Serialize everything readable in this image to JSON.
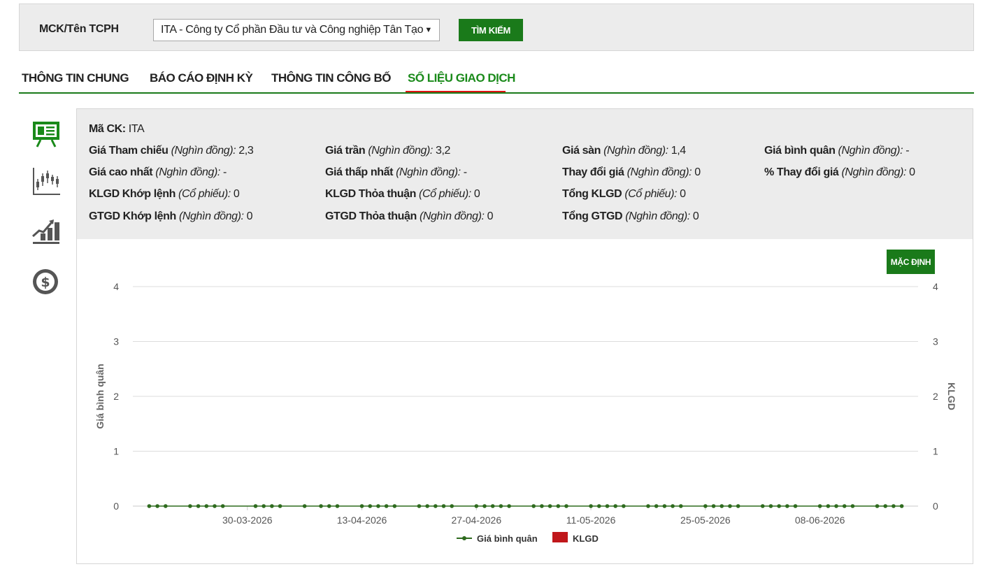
{
  "search": {
    "label": "MCK/Tên TCPH",
    "selected_company": "ITA - Công ty Cổ phần Đầu tư và Công nghiệp Tân Tạo",
    "button_label": "TÌM KIẾM"
  },
  "tabs": [
    {
      "label": "THÔNG TIN CHUNG"
    },
    {
      "label": "BÁO CÁO ĐỊNH KỲ"
    },
    {
      "label": "THÔNG TIN CÔNG BỐ"
    },
    {
      "label": "SỐ LIỆU GIAO DỊCH"
    }
  ],
  "active_tab": "SỐ LIỆU GIAO DỊCH",
  "side_icons": [
    "presentation-board-icon",
    "candlestick-chart-icon",
    "bar-growth-chart-icon",
    "dollar-coin-icon"
  ],
  "info": {
    "ma_ck": {
      "key": "Mã CK:",
      "value": "ITA"
    },
    "rows": [
      [
        {
          "key": "Giá Tham chiếu",
          "unit": "(Nghìn đồng):",
          "value": "2,3"
        },
        {
          "key": "Giá trần",
          "unit": "(Nghìn đồng):",
          "value": "3,2"
        },
        {
          "key": "Giá sàn",
          "unit": "(Nghìn đồng):",
          "value": "1,4"
        },
        {
          "key": "Giá bình quân",
          "unit": "(Nghìn đồng):",
          "value": "-"
        }
      ],
      [
        {
          "key": "Giá cao nhất",
          "unit": "(Nghìn đồng):",
          "value": "-"
        },
        {
          "key": "Giá thấp nhất",
          "unit": "(Nghìn đồng):",
          "value": "-"
        },
        {
          "key": "Thay đổi giá",
          "unit": "(Nghìn đồng):",
          "value": "0"
        },
        {
          "key": "% Thay đổi giá",
          "unit": "(Nghìn đồng):",
          "value": "0"
        }
      ],
      [
        {
          "key": "KLGD Khớp lệnh",
          "unit": "(Cổ phiếu):",
          "value": "0"
        },
        {
          "key": "KLGD Thỏa thuận",
          "unit": "(Cổ phiếu):",
          "value": "0"
        },
        {
          "key": "Tổng KLGD",
          "unit": "(Cổ phiếu):",
          "value": "0"
        }
      ],
      [
        {
          "key": "GTGD Khớp lệnh",
          "unit": "(Nghìn đồng):",
          "value": "0"
        },
        {
          "key": "GTGD Thỏa thuận",
          "unit": "(Nghìn đồng):",
          "value": "0"
        },
        {
          "key": "Tổng GTGD",
          "unit": "(Nghìn đồng):",
          "value": "0"
        }
      ]
    ]
  },
  "chart_button_label": "MẶC ĐỊNH",
  "colors": {
    "accent_green": "#1a7a1a",
    "tab_underline_red": "#dd1111",
    "line_series": "#2e6b1e",
    "bar_series": "#c0171b"
  },
  "chart_data": {
    "type": "line",
    "ylabel": "Giá bình quân",
    "y2label": "KLGD",
    "ylim": [
      0,
      4
    ],
    "y2lim": [
      0,
      4
    ],
    "yticks": [
      0,
      1,
      2,
      3,
      4
    ],
    "grid": true,
    "legend_position": "bottom",
    "xtick_labels": [
      "30-03-2026",
      "13-04-2026",
      "27-04-2026",
      "11-05-2026",
      "25-05-2026",
      "08-06-2026"
    ],
    "series": [
      {
        "name": "Giá bình quân",
        "x": [
          "2026-03-18",
          "2026-03-19",
          "2026-03-20",
          "2026-03-23",
          "2026-03-24",
          "2026-03-25",
          "2026-03-26",
          "2026-03-27",
          "2026-03-31",
          "2026-04-01",
          "2026-04-02",
          "2026-04-03",
          "2026-04-06",
          "2026-04-08",
          "2026-04-09",
          "2026-04-10",
          "2026-04-13",
          "2026-04-14",
          "2026-04-15",
          "2026-04-16",
          "2026-04-17",
          "2026-04-20",
          "2026-04-21",
          "2026-04-22",
          "2026-04-23",
          "2026-04-24",
          "2026-04-27",
          "2026-04-28",
          "2026-04-29",
          "2026-04-30",
          "2026-05-01",
          "2026-05-04",
          "2026-05-05",
          "2026-05-06",
          "2026-05-07",
          "2026-05-08",
          "2026-05-11",
          "2026-05-12",
          "2026-05-13",
          "2026-05-14",
          "2026-05-15",
          "2026-05-18",
          "2026-05-19",
          "2026-05-20",
          "2026-05-21",
          "2026-05-22",
          "2026-05-25",
          "2026-05-26",
          "2026-05-27",
          "2026-05-28",
          "2026-05-29",
          "2026-06-01",
          "2026-06-02",
          "2026-06-03",
          "2026-06-04",
          "2026-06-05",
          "2026-06-08",
          "2026-06-09",
          "2026-06-10",
          "2026-06-11",
          "2026-06-12",
          "2026-06-15",
          "2026-06-16",
          "2026-06-17",
          "2026-06-18"
        ],
        "values": [
          0,
          0,
          0,
          0,
          0,
          0,
          0,
          0,
          0,
          0,
          0,
          0,
          0,
          0,
          0,
          0,
          0,
          0,
          0,
          0,
          0,
          0,
          0,
          0,
          0,
          0,
          0,
          0,
          0,
          0,
          0,
          0,
          0,
          0,
          0,
          0,
          0,
          0,
          0,
          0,
          0,
          0,
          0,
          0,
          0,
          0,
          0,
          0,
          0,
          0,
          0,
          0,
          0,
          0,
          0,
          0,
          0,
          0,
          0,
          0,
          0,
          0,
          0,
          0,
          0
        ]
      },
      {
        "name": "KLGD",
        "x": [],
        "values": []
      }
    ]
  }
}
